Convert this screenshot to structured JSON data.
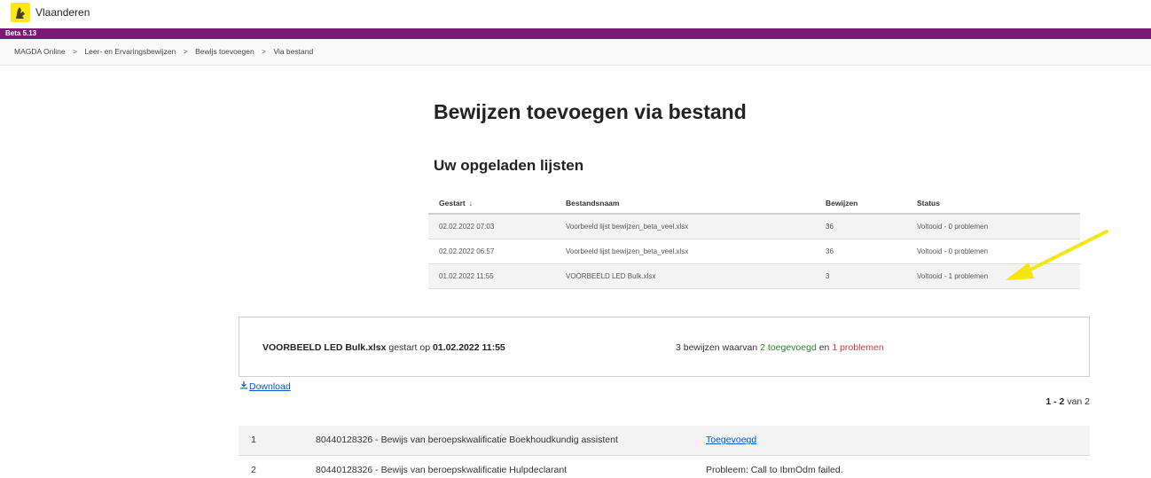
{
  "header": {
    "brand": "Vlaanderen",
    "beta_label": "Beta 5.13"
  },
  "breadcrumb": [
    "MAGDA Online",
    "Leer- en Ervaringsbewijzen",
    "Bewijs toevoegen",
    "Via bestand"
  ],
  "breadcrumb_separator": ">",
  "page_title": "Bewijzen toevoegen via bestand",
  "section_title": "Uw opgeladen lijsten",
  "uploads": {
    "headers": {
      "gestart": "Gestart",
      "gestart_sort_icon": "↓",
      "bestandsnaam": "Bestandsnaam",
      "bewijzen": "Bewijzen",
      "status": "Status"
    },
    "rows": [
      {
        "gestart": "02.02.2022 07:03",
        "bestandsnaam": "Voorbeeld lijst bewijzen_beta_veel.xlsx",
        "bewijzen": "36",
        "status": "Voltooid - 0 problemen"
      },
      {
        "gestart": "02.02.2022 06:57",
        "bestandsnaam": "Voorbeeld lijst bewijzen_beta_veel.xlsx",
        "bewijzen": "36",
        "status": "Voltooid - 0 problemen"
      },
      {
        "gestart": "01.02.2022 11:55",
        "bestandsnaam": "VOORBEELD LED Bulk.xlsx",
        "bewijzen": "3",
        "status": "Voltooid - 1 problemen"
      }
    ]
  },
  "annotation": {
    "icon": "arrow-icon",
    "color": "#f5e60c"
  },
  "summary": {
    "filename": "VOORBEELD LED Bulk.xlsx",
    "started_text": "gestart op",
    "started_at": "01.02.2022 11:55",
    "count_text": "3 bewijzen waarvan",
    "added_text": "2 toegevoegd",
    "and_text": "en",
    "problems_text": "1 problemen"
  },
  "download": {
    "icon": "download-icon",
    "label": "Download"
  },
  "pagination": {
    "range": "1 - 2",
    "of_text": "van 2"
  },
  "results": [
    {
      "nr": "1",
      "description": "80440128326 - Bewijs van beroepskwalificatie Boekhoudkundig assistent",
      "status": "Toegevoegd",
      "error": false
    },
    {
      "nr": "2",
      "description": "80440128326 - Bewijs van beroepskwalificatie Hulpdeclarant",
      "status": "Probleem: Call to IbmOdm failed.",
      "error": true
    }
  ],
  "colors": {
    "beta_bar": "#7a1a75",
    "logo": "#ffe615",
    "success": "#2a7d30",
    "error": "#d2373c",
    "link": "#0055cc"
  }
}
